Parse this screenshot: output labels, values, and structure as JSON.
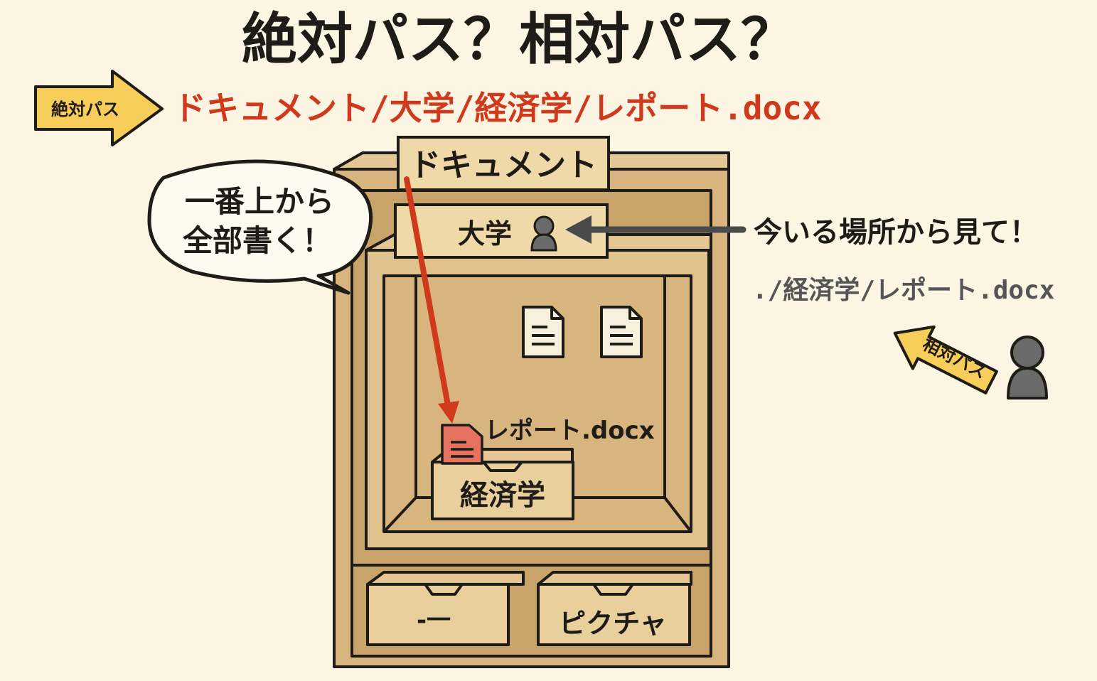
{
  "title": "絶対パス？相対パス？",
  "absolute": {
    "arrow_label": "絶対パス",
    "path": "ドキュメント/大学/経済学/レポート.docx",
    "bubble_line1": "一番上から",
    "bubble_line2": "全部書く！"
  },
  "relative": {
    "caption": "今いる場所から見て！",
    "path": "./経済学/レポート.docx",
    "arrow_label": "相対パス"
  },
  "cabinet": {
    "root_label": "ドキュメント",
    "folder_label": "大学",
    "subfolder_label": "経済学",
    "file_label": "レポート.docx",
    "drawer_left_label": "-一",
    "drawer_right_label": "ピクチャ"
  },
  "colors": {
    "background": "#fcf5e4",
    "wood": "#d8b57e",
    "wood_light": "#e4c794",
    "wood_dark": "#c39a5e",
    "ink": "#1f1b16",
    "accent_red": "#cf3a1c",
    "arrow_yellow": "#f7cd5a",
    "person_gray": "#6a6a6a",
    "file_red": "#e57360"
  },
  "icons": [
    "arrow-right-icon",
    "arrow-left-icon",
    "person-icon",
    "document-icon",
    "speech-bubble-icon"
  ]
}
